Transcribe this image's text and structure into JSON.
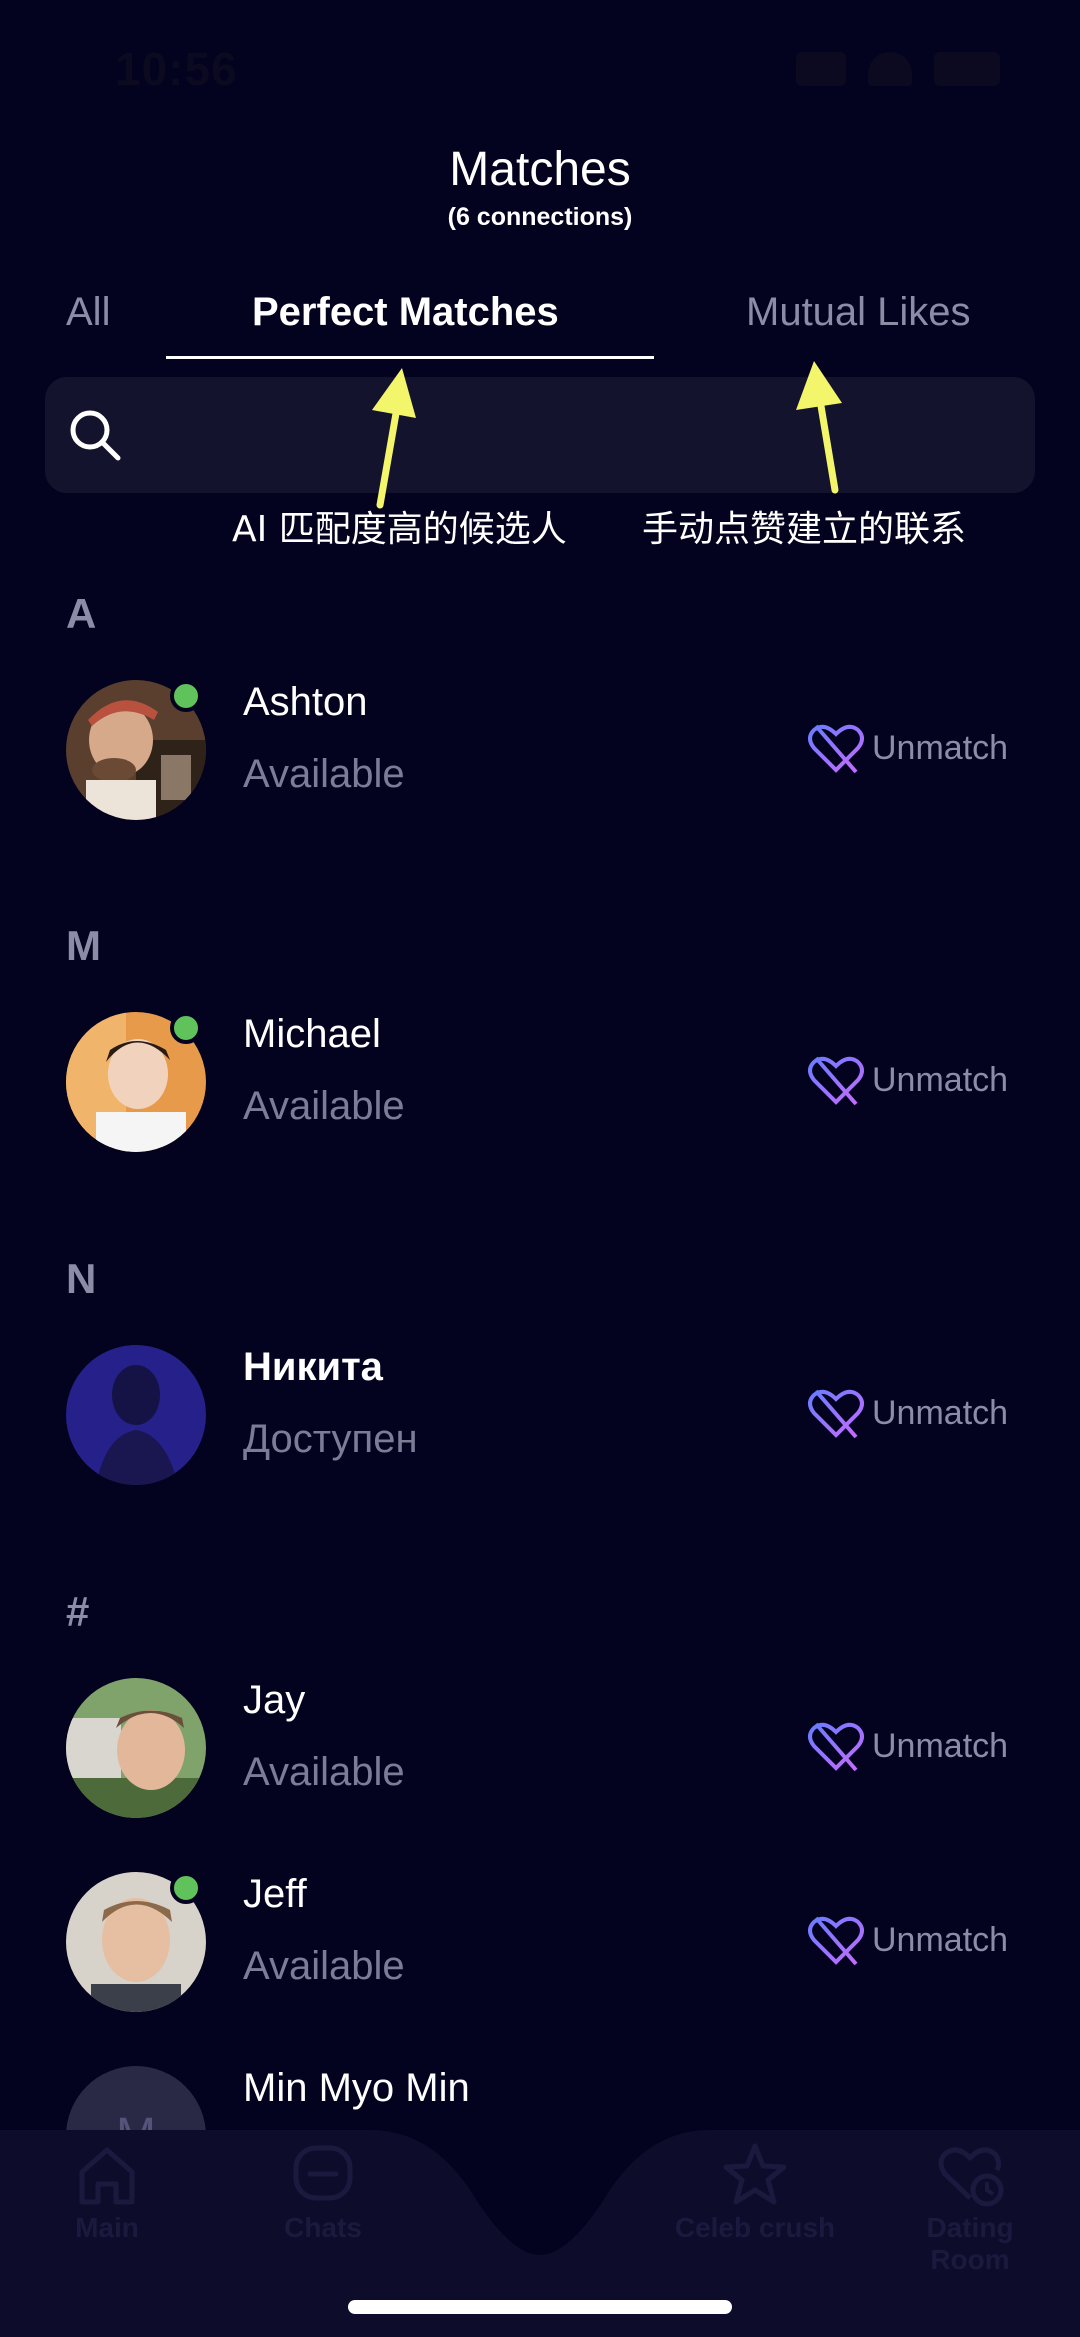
{
  "status_bar": {
    "time": "10:56"
  },
  "header": {
    "title": "Matches",
    "subtitle": "(6 connections)"
  },
  "tabs": [
    {
      "label": "All",
      "active": false
    },
    {
      "label": "Perfect Matches",
      "active": true
    },
    {
      "label": "Mutual Likes",
      "active": false
    }
  ],
  "search": {
    "placeholder": ""
  },
  "annotations": {
    "left": "AI 匹配度高的候选人",
    "right": "手动点赞建立的联系",
    "arrow_color": "#f3f56a"
  },
  "sections": [
    {
      "letter": "A",
      "contacts": [
        {
          "name": "Ashton",
          "status": "Available",
          "online": true
        }
      ]
    },
    {
      "letter": "M",
      "contacts": [
        {
          "name": "Michael",
          "status": "Available",
          "online": true
        }
      ]
    },
    {
      "letter": "N",
      "contacts": [
        {
          "name": "Никита",
          "status": "Доступен",
          "online": false
        }
      ]
    },
    {
      "letter": "#",
      "contacts": [
        {
          "name": "Jay",
          "status": "Available",
          "online": false
        },
        {
          "name": "Jeff",
          "status": "Available",
          "online": true
        },
        {
          "name": "Min Myo Min",
          "status": "",
          "online": false,
          "avatar_initial": "M"
        }
      ]
    }
  ],
  "unmatch_label": "Unmatch",
  "bottom_nav": [
    {
      "label": "Main",
      "icon": "home-icon"
    },
    {
      "label": "Chats",
      "icon": "chat-icon"
    },
    {
      "label": "Celeb crush",
      "icon": "star-icon"
    },
    {
      "label": "Dating Room",
      "icon": "heart-clock-icon"
    }
  ],
  "colors": {
    "background": "#04031f",
    "online": "#5fc25b",
    "unmatch_gradient": [
      "#6a7cff",
      "#c56bff"
    ]
  }
}
